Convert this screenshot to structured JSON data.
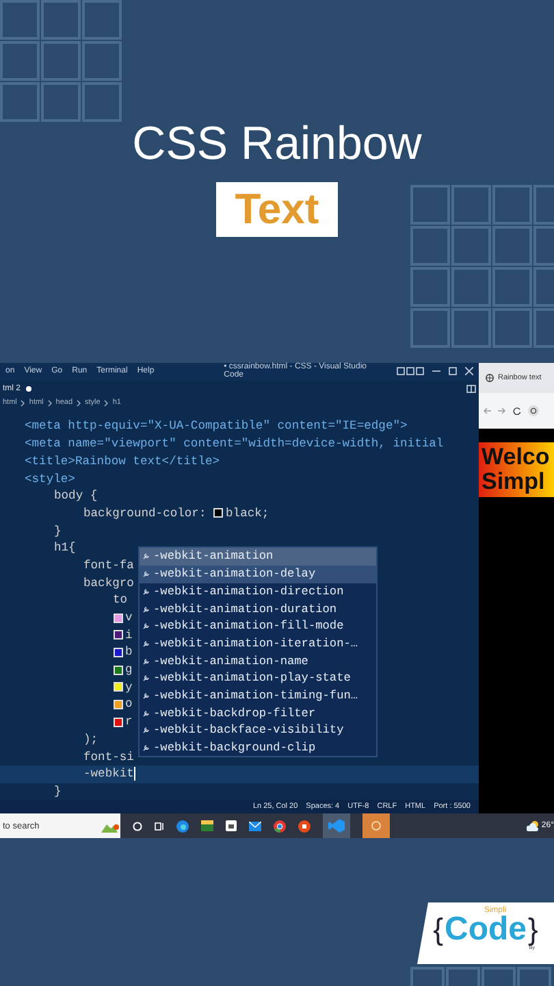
{
  "hero": {
    "title": "CSS Rainbow",
    "highlight": "Text"
  },
  "editor": {
    "menu": [
      "on",
      "View",
      "Go",
      "Run",
      "Terminal",
      "Help"
    ],
    "title": "• cssrainbow.html - CSS - Visual Studio Code",
    "tab": {
      "label": "tml 2",
      "modified": true
    },
    "breadcrumb": [
      "html",
      "html",
      "head",
      "style",
      "h1"
    ],
    "lines": [
      {
        "code": "<meta http-equiv=\"X-UA-Compatible\" content=\"IE=edge\">"
      },
      {
        "code": "<meta name=\"viewport\" content=\"width=device-width, initial"
      },
      {
        "code": "<title>Rainbow text</title>"
      },
      {
        "code": "<style>",
        "children": [
          {
            "code": "body {",
            "children": [
              {
                "code": "background-color:",
                "color": "#000000",
                "after": "black;"
              }
            ]
          },
          {
            "code": "}"
          },
          {
            "code": "h1{",
            "children": [
              {
                "code": "font-fa"
              },
              {
                "code": "backgro",
                "children": [
                  {
                    "code": "to"
                  },
                  {
                    "color": "#e69ae6",
                    "code": "v"
                  },
                  {
                    "color": "#4b1a7a",
                    "code": "i"
                  },
                  {
                    "color": "#1a1acc",
                    "code": "b"
                  },
                  {
                    "color": "#1a7a1a",
                    "code": "g"
                  },
                  {
                    "color": "#eeee22",
                    "code": "y"
                  },
                  {
                    "color": "#f0a020",
                    "code": "o"
                  },
                  {
                    "color": "#dd1111",
                    "code": "r"
                  }
                ]
              },
              {
                "code": ");"
              },
              {
                "code": "font-si"
              },
              {
                "code": "-webkit",
                "current": true
              }
            ]
          },
          {
            "code": "}"
          }
        ]
      }
    ],
    "suggestions": [
      {
        "label": "-webkit-animation",
        "selected": true
      },
      {
        "label": "-webkit-animation-delay",
        "selected": false,
        "hovered": true
      },
      {
        "label": "-webkit-animation-direction",
        "selected": false
      },
      {
        "label": "-webkit-animation-duration",
        "selected": false
      },
      {
        "label": "-webkit-animation-fill-mode",
        "selected": false
      },
      {
        "label": "-webkit-animation-iteration-…",
        "selected": false
      },
      {
        "label": "-webkit-animation-name",
        "selected": false
      },
      {
        "label": "-webkit-animation-play-state",
        "selected": false
      },
      {
        "label": "-webkit-animation-timing-fun…",
        "selected": false
      },
      {
        "label": "-webkit-backdrop-filter",
        "selected": false
      },
      {
        "label": "-webkit-backface-visibility",
        "selected": false
      },
      {
        "label": "-webkit-background-clip",
        "selected": false
      }
    ],
    "status_bar": [
      "Ln 25, Col 20",
      "Spaces: 4",
      "UTF-8",
      "CRLF",
      "HTML",
      "Port : 5500"
    ]
  },
  "browser": {
    "tab": "Rainbow text",
    "heading_lines": [
      "Welco",
      "Simpl"
    ]
  },
  "taskbar": {
    "search": "to search",
    "weather": "26°"
  },
  "logo": {
    "top": "Simpli",
    "open": "{",
    "word": "Code",
    "close": "}",
    "byline": "By"
  }
}
